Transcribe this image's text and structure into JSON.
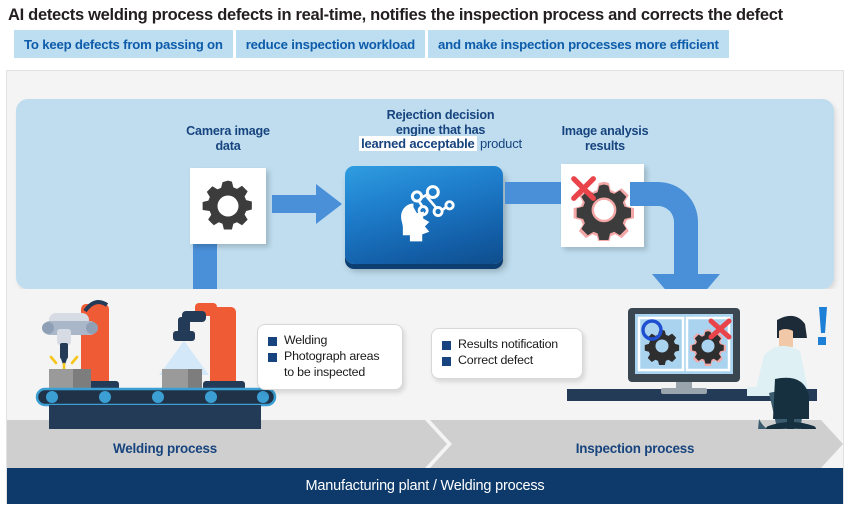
{
  "title": "AI detects welding process defects in real-time, notifies the inspection process and corrects the defect",
  "subtitle_chips": [
    {
      "label": "To keep defects from passing on"
    },
    {
      "label": "reduce inspection workload"
    },
    {
      "label": "and make inspection processes more efficient"
    }
  ],
  "diagram": {
    "camera_label_line1": "Camera image",
    "camera_label_line2": "data",
    "engine_label_line1": "Rejection decision",
    "engine_label_line2": "engine that has",
    "engine_label_line3_highlight": "learned acceptable",
    "engine_label_line3_tail": " product",
    "analysis_label_line1": "Image analysis",
    "analysis_label_line2": "results"
  },
  "callouts": {
    "welding": {
      "items": [
        "Welding",
        "Photograph areas",
        "to be inspected"
      ]
    },
    "inspection": {
      "items": [
        "Results notification",
        "Correct defect"
      ]
    }
  },
  "stages": [
    {
      "label": "Welding process"
    },
    {
      "label": "Inspection process"
    }
  ],
  "banner": {
    "label": "Manufacturing plant / Welding process"
  },
  "colors": {
    "title_text": "#231f20",
    "chip_bg": "#bdddf0",
    "chip_text": "#0d5cab",
    "panel_bg": "#bfddef",
    "label_text": "#17447e",
    "arrow_blue": "#4a90d9",
    "banner_bg": "#0d3a6b",
    "chevron_bg": "#cfcfcf",
    "robot_orange": "#ef5b35",
    "conveyor_navy": "#243b57",
    "defect_red": "#e8444a",
    "gear_dark": "#3c3c3c"
  }
}
